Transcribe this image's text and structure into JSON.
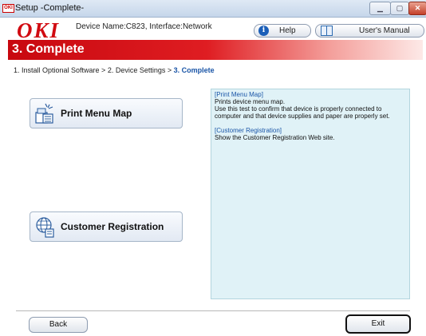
{
  "window": {
    "title": "Setup -Complete-",
    "app_icon_text": "OKI"
  },
  "header": {
    "logo": "OKI",
    "device_info": "Device Name:C823, Interface:Network",
    "help_label": "Help",
    "manual_label": "User's Manual"
  },
  "banner": {
    "title": "3. Complete"
  },
  "breadcrumb": {
    "prefix": "1. Install Optional Software > 2. Device Settings > ",
    "current": "3. Complete"
  },
  "actions": {
    "print_menu_map": "Print Menu Map",
    "customer_registration": "Customer Registration"
  },
  "description": {
    "pmm_heading": "[Print Menu Map]",
    "pmm_line1": "Prints device menu map.",
    "pmm_line2": "Use this test to confirm that device is properly connected to computer and that device supplies and paper are properly set.",
    "cr_heading": "[Customer Registration]",
    "cr_line1": "Show the Customer Registration Web site."
  },
  "footer": {
    "back_label": "Back",
    "exit_label": "Exit"
  },
  "colors": {
    "brand_red": "#d10a11",
    "link_blue": "#1a55a7",
    "desc_bg": "#e0f2f7"
  }
}
